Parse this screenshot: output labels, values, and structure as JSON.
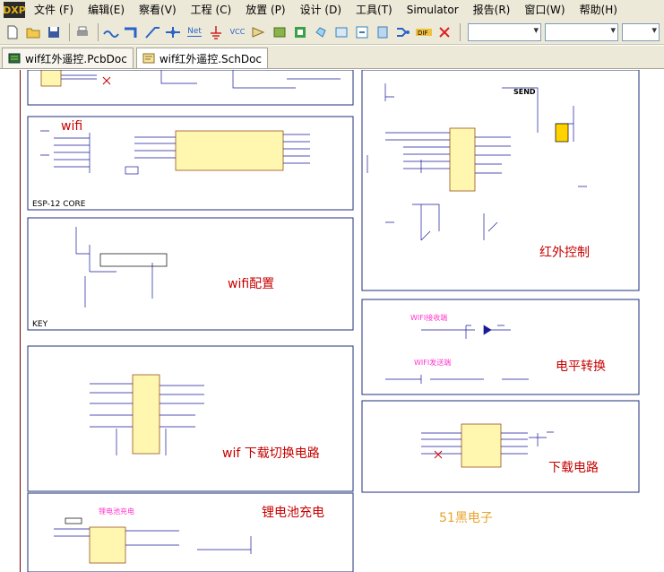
{
  "app": {
    "logo_text": "DXP",
    "menu": [
      "文件 (F)",
      "编辑(E)",
      "察看(V)",
      "工程 (C)",
      "放置 (P)",
      "设计 (D)",
      "工具(T)",
      "Simulator",
      "报告(R)",
      "窗口(W)",
      "帮助(H)"
    ]
  },
  "toolbar": {
    "icons": [
      "new-file-icon",
      "open-folder-icon",
      "save-icon",
      "print-icon",
      "wire-icon",
      "bus-icon",
      "bus-entry-icon",
      "junction-icon",
      "net-label-icon",
      "ground-icon",
      "vcc-icon",
      "part-icon",
      "sheet-symbol-icon",
      "sheet-entry-icon",
      "device-sheet-icon",
      "port-icon",
      "harness-icon",
      "compile-icon",
      "no-erc-icon"
    ],
    "net_label_text": "Net",
    "vcc_text": "VCC",
    "combos": [
      "",
      "",
      ""
    ]
  },
  "tabs": [
    {
      "label": "wif红外遥控.PcbDoc",
      "active": false
    },
    {
      "label": "wif红外遥控.SchDoc",
      "active": true
    }
  ],
  "schematic": {
    "blocks": {
      "wifi": {
        "title": "wifi",
        "subtitle": "ESP-12 CORE"
      },
      "key": {
        "title": "wifi配置",
        "subtitle": "KEY"
      },
      "switch": {
        "title": "wif 下载切换电路"
      },
      "battery": {
        "title": "锂电池充电"
      },
      "ir": {
        "title": "红外控制",
        "send": "SEND"
      },
      "level": {
        "title": "电平转换",
        "note1": "WIFI接收端",
        "note2": "WIFI发送端"
      },
      "download": {
        "title": "下载电路"
      },
      "charge_note": "锂电池充电"
    },
    "watermark": "51黑电子"
  }
}
